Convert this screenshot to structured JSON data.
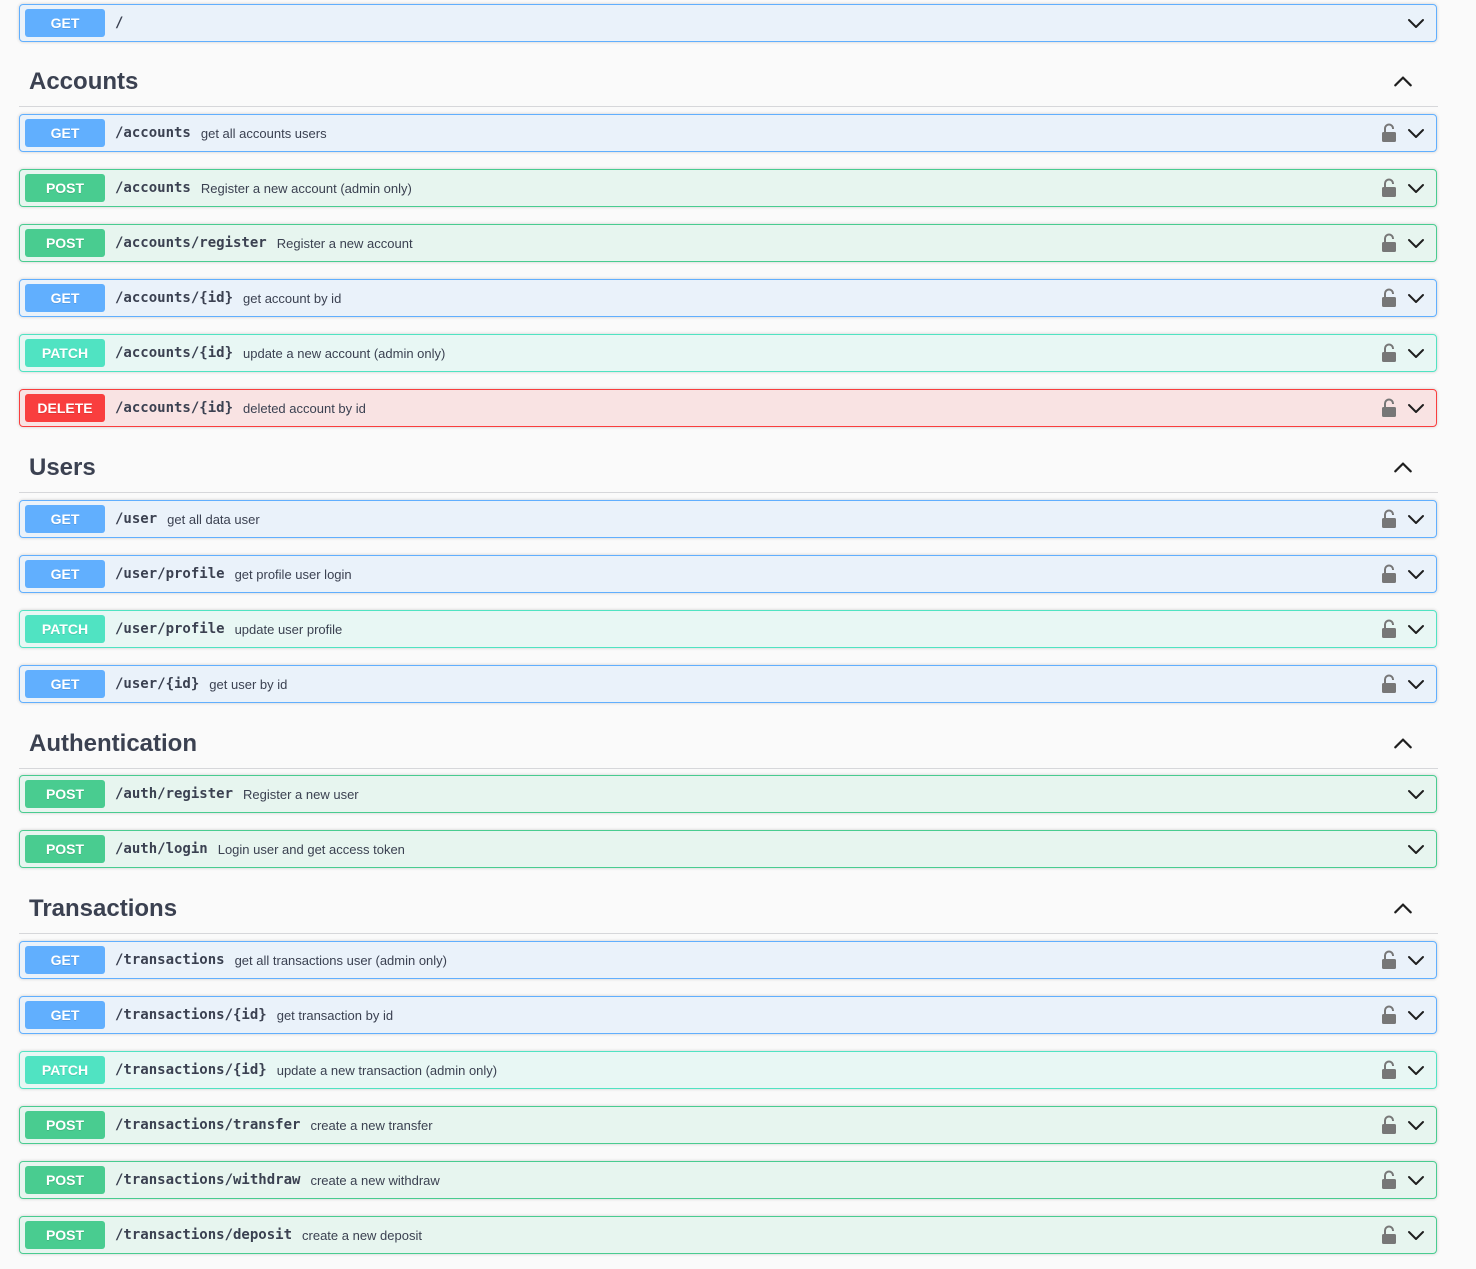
{
  "root_operation": {
    "method": "GET",
    "path": "/",
    "summary": "",
    "locked": false
  },
  "sections": [
    {
      "name": "Accounts",
      "operations": [
        {
          "method": "GET",
          "path": "/accounts",
          "summary": "get all accounts users",
          "locked": true
        },
        {
          "method": "POST",
          "path": "/accounts",
          "summary": "Register a new account (admin only)",
          "locked": true
        },
        {
          "method": "POST",
          "path": "/accounts/register",
          "summary": "Register a new account",
          "locked": true
        },
        {
          "method": "GET",
          "path": "/accounts/{id}",
          "summary": "get account by id",
          "locked": true
        },
        {
          "method": "PATCH",
          "path": "/accounts/{id}",
          "summary": "update a new account (admin only)",
          "locked": true
        },
        {
          "method": "DELETE",
          "path": "/accounts/{id}",
          "summary": "deleted account by id",
          "locked": true
        }
      ]
    },
    {
      "name": "Users",
      "operations": [
        {
          "method": "GET",
          "path": "/user",
          "summary": "get all data user",
          "locked": true
        },
        {
          "method": "GET",
          "path": "/user/profile",
          "summary": "get profile user login",
          "locked": true
        },
        {
          "method": "PATCH",
          "path": "/user/profile",
          "summary": "update user profile",
          "locked": true
        },
        {
          "method": "GET",
          "path": "/user/{id}",
          "summary": "get user by id",
          "locked": true
        }
      ]
    },
    {
      "name": "Authentication",
      "operations": [
        {
          "method": "POST",
          "path": "/auth/register",
          "summary": "Register a new user",
          "locked": false
        },
        {
          "method": "POST",
          "path": "/auth/login",
          "summary": "Login user and get access token",
          "locked": false
        }
      ]
    },
    {
      "name": "Transactions",
      "operations": [
        {
          "method": "GET",
          "path": "/transactions",
          "summary": "get all transactions user (admin only)",
          "locked": true
        },
        {
          "method": "GET",
          "path": "/transactions/{id}",
          "summary": "get transaction by id",
          "locked": true
        },
        {
          "method": "PATCH",
          "path": "/transactions/{id}",
          "summary": "update a new transaction (admin only)",
          "locked": true
        },
        {
          "method": "POST",
          "path": "/transactions/transfer",
          "summary": "create a new transfer",
          "locked": true
        },
        {
          "method": "POST",
          "path": "/transactions/withdraw",
          "summary": "create a new withdraw",
          "locked": true
        },
        {
          "method": "POST",
          "path": "/transactions/deposit",
          "summary": "create a new deposit",
          "locked": true
        }
      ]
    }
  ],
  "colors": {
    "get": "#61affe",
    "post": "#49cc90",
    "patch": "#50e3c2",
    "delete": "#f93e3e",
    "text": "#3b4151"
  },
  "icons": {
    "lock": "unlocked-padlock-icon",
    "expand": "chevron-down-icon",
    "collapse": "chevron-up-icon"
  }
}
